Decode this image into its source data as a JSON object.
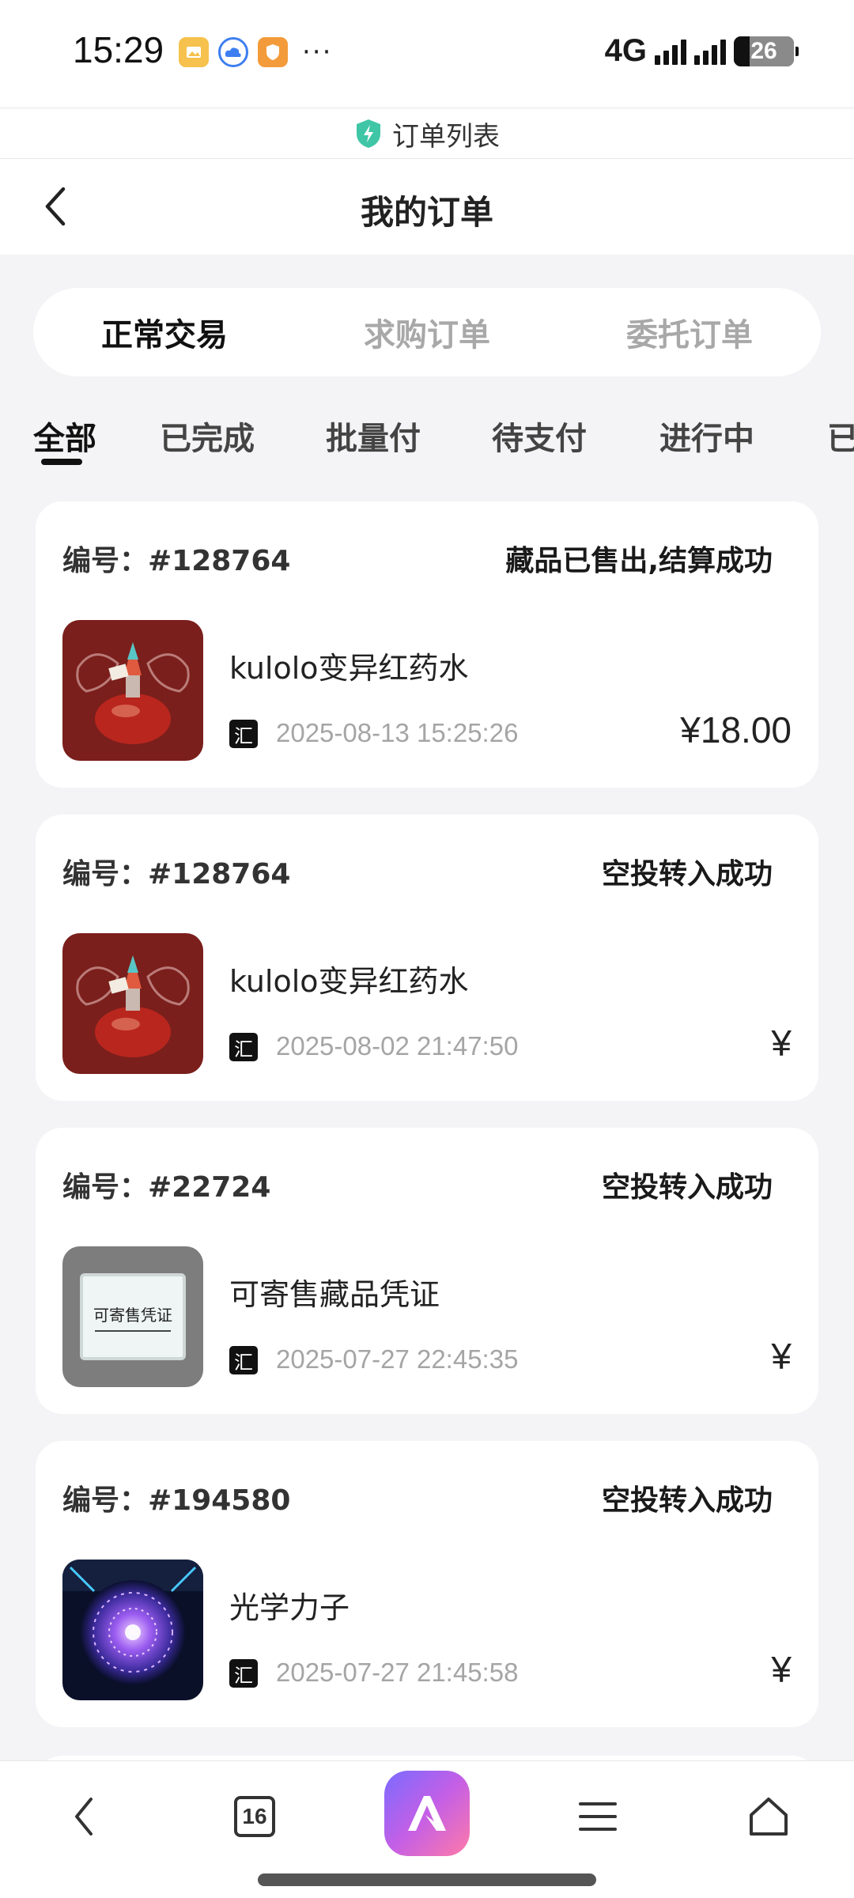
{
  "status_bar": {
    "time": "15:29",
    "network": "4G",
    "battery": "26",
    "battery_level": 0.26,
    "more": "···"
  },
  "site_bar": {
    "title": "订单列表",
    "icon": "shield-icon",
    "accent": "#3fc6a6"
  },
  "header": {
    "title": "我的订单",
    "back_icon": "chevron-left-icon"
  },
  "segments": [
    {
      "label": "正常交易",
      "active": true
    },
    {
      "label": "求购订单",
      "active": false
    },
    {
      "label": "委托订单",
      "active": false
    }
  ],
  "filters": [
    {
      "label": "全部",
      "active": true
    },
    {
      "label": "已完成",
      "active": false
    },
    {
      "label": "批量付",
      "active": false
    },
    {
      "label": "待支付",
      "active": false
    },
    {
      "label": "进行中",
      "active": false
    },
    {
      "label": "已",
      "active": false
    }
  ],
  "orders": [
    {
      "id": "编号：#128764",
      "status": "藏品已售出,结算成功",
      "name": "kulolo变异红药水",
      "mark": "汇",
      "date": "2025-08-13 15:25:26",
      "price": "¥18.00",
      "image": "potion"
    },
    {
      "id": "编号：#128764",
      "status": "空投转入成功",
      "name": "kulolo变异红药水",
      "mark": "汇",
      "date": "2025-08-02 21:47:50",
      "price": "¥",
      "image": "potion"
    },
    {
      "id": "编号：#22724",
      "status": "空投转入成功",
      "name": "可寄售藏品凭证",
      "mark": "汇",
      "date": "2025-07-27 22:45:35",
      "price": "¥",
      "image": "voucher",
      "image_text": "可寄售凭证"
    },
    {
      "id": "编号：#194580",
      "status": "空投转入成功",
      "name": "光学力子",
      "mark": "汇",
      "date": "2025-07-27 21:45:58",
      "price": "¥",
      "image": "orb"
    }
  ],
  "bottom_nav": {
    "back_icon": "chevron-left-icon",
    "tab_count": "16",
    "app_icon": "browser-app-icon",
    "menu_icon": "menu-icon",
    "home_icon": "home-icon"
  }
}
